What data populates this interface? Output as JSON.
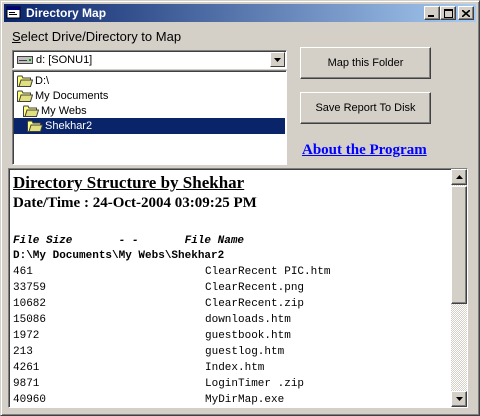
{
  "window": {
    "title": "Directory Map",
    "controls": {
      "minimize": "_",
      "maximize": "□",
      "close": "×"
    }
  },
  "drive_label": "Select Drive/Directory to Map",
  "drive_label_accel": "S",
  "drive_label_rest": "elect Drive/Directory to Map",
  "drive_combo": {
    "value": "d: [SONU1]",
    "icon": "drive-icon"
  },
  "directory_tree": [
    {
      "label": "D:\\",
      "icon": "open-folder-icon",
      "selected": false
    },
    {
      "label": "My Documents",
      "icon": "open-folder-icon",
      "selected": false
    },
    {
      "label": "My Webs",
      "icon": "open-folder-icon",
      "selected": false
    },
    {
      "label": "Shekhar2",
      "icon": "open-folder-icon",
      "selected": true
    }
  ],
  "buttons": {
    "map_folder": "Map this Folder",
    "save_report": "Save Report To Disk"
  },
  "about_link": "About the Program",
  "output": {
    "heading": "Directory Structure by Shekhar",
    "datetime": "Date/Time : 24-Oct-2004 03:09:25 PM",
    "column_header": "File Size       - -       File Name",
    "path": "D:\\My Documents\\My Webs\\Shekhar2",
    "files": [
      {
        "size": "461",
        "name": "ClearRecent PIC.htm"
      },
      {
        "size": "33759",
        "name": "ClearRecent.png"
      },
      {
        "size": "10682",
        "name": "ClearRecent.zip"
      },
      {
        "size": "15086",
        "name": "downloads.htm"
      },
      {
        "size": "1972",
        "name": "guestbook.htm"
      },
      {
        "size": "213",
        "name": "guestlog.htm"
      },
      {
        "size": "4261",
        "name": "Index.htm"
      },
      {
        "size": "9871",
        "name": "LoginTimer .zip"
      },
      {
        "size": "40960",
        "name": "MyDirMap.exe"
      }
    ]
  },
  "colors": {
    "title_bar_start": "#0a246a",
    "title_bar_end": "#a6caf0",
    "selection": "#0a246a",
    "link": "#0000ff",
    "face": "#d4d0c8"
  }
}
